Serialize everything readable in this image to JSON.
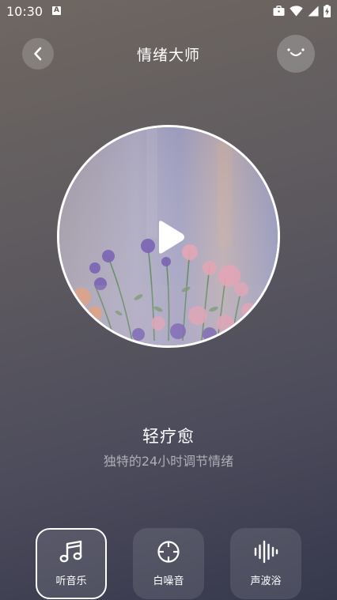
{
  "status_bar": {
    "time": "10:30",
    "notification_glyph": "A",
    "icons": [
      "briefcase-icon",
      "wifi-icon",
      "cell-signal-icon",
      "battery-charging-icon"
    ]
  },
  "header": {
    "title": "情绪大师",
    "back_icon": "chevron-left-icon",
    "mood_icon": "smile-face-icon"
  },
  "player": {
    "state": "paused",
    "track_title": "轻疗愈",
    "track_subtitle": "独特的24小时调节情绪"
  },
  "modes": [
    {
      "label": "听音乐",
      "icon": "music-note-icon",
      "active": true
    },
    {
      "label": "白噪音",
      "icon": "crosshair-circle-icon",
      "active": false
    },
    {
      "label": "声波浴",
      "icon": "sound-wave-icon",
      "active": false
    }
  ],
  "colors": {
    "background_top": "#6f6761",
    "background_bottom": "#36384c",
    "accent": "#ffffff"
  }
}
